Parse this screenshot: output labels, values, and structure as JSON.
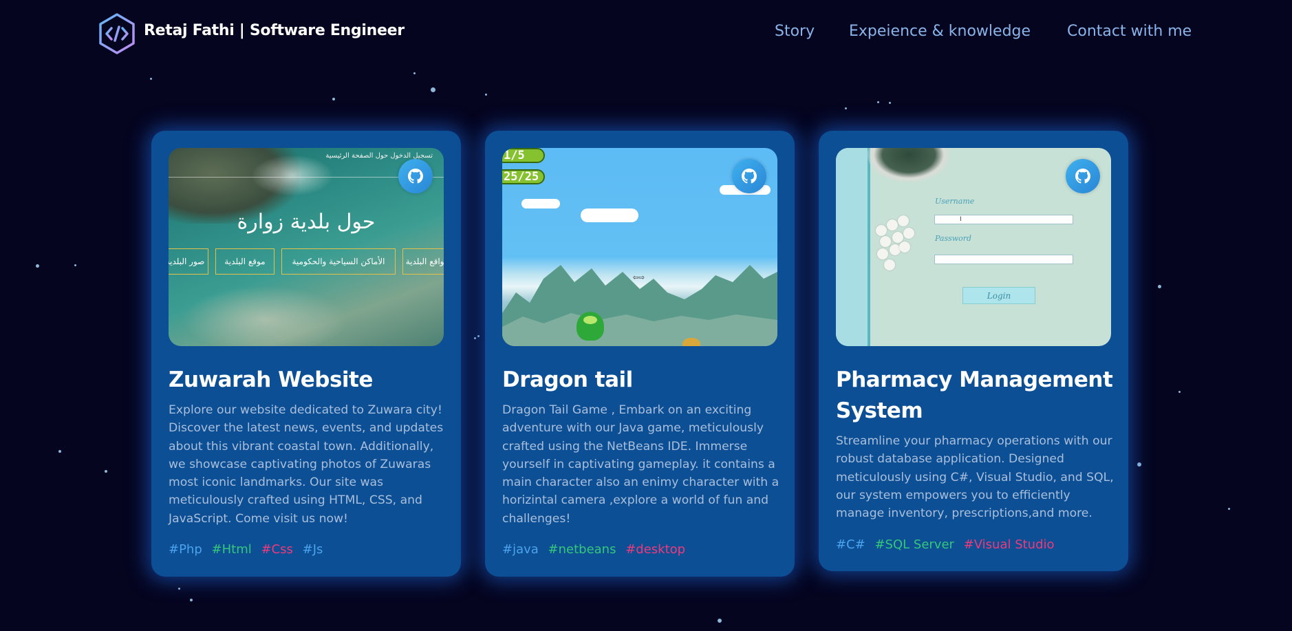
{
  "header": {
    "brand": "Retaj Fathi  | Software Engineer",
    "logo_icon": "code-brackets-icon",
    "nav": [
      "Story",
      "Expeience & knowledge",
      "Contact with me"
    ]
  },
  "projects": [
    {
      "title": "Zuwarah Website",
      "description": "Explore our website dedicated to Zuwara city! Discover the latest news, events, and updates about this vibrant coastal town. Additionally, we showcase captivating photos of Zuwaras most iconic landmarks. Our site was meticulously crafted using HTML, CSS, and JavaScript. Come visit us now!",
      "tags": [
        "#Php",
        "#Html",
        "#Css",
        "#Js"
      ],
      "github_icon": "github-icon",
      "screenshot": {
        "nav": "تسجيل الدخول  حول  الصفحة الرئيسية",
        "heading": "حول بلدية زوارة",
        "buttons": [
          "صور البلدية",
          "موقع البلدية",
          "الأماكن السياحية والحكومية",
          "مواقع البلدية"
        ]
      }
    },
    {
      "title": "Dragon tail",
      "description": "Dragon Tail Game , Embark on an exciting adventure with our Java game, meticulously crafted using the NetBeans IDE. Immerse yourself in captivating gameplay. it contains a main character also an enimy character with a horizintal camera ,explore a world of fun and challenges!",
      "tags": [
        "#java",
        "#netbeans",
        "#desktop"
      ],
      "github_icon": "github-icon",
      "screenshot": {
        "hud_lives": "1/5",
        "hud_health": "25/25",
        "arrows": "⇦⇨"
      }
    },
    {
      "title": "Pharmacy Management System",
      "description": "Streamline your pharmacy operations with our robust database application. Designed meticulously using C#, Visual Studio, and SQL, our system empowers you to efficiently manage inventory, prescriptions,and more.",
      "tags": [
        "#C#",
        "#SQL Server",
        "#Visual Studio"
      ],
      "github_icon": "github-icon",
      "screenshot": {
        "username_label": "Username",
        "username_value": "I",
        "password_label": "Password",
        "login_button": "Login"
      }
    }
  ],
  "colors": {
    "background": "#050520",
    "card": "#0d4f94",
    "nav_text": "#8ab4e8",
    "tag_blue": "#4aa3ee",
    "tag_green": "#34c77b",
    "tag_pink": "#ee3a7c"
  }
}
